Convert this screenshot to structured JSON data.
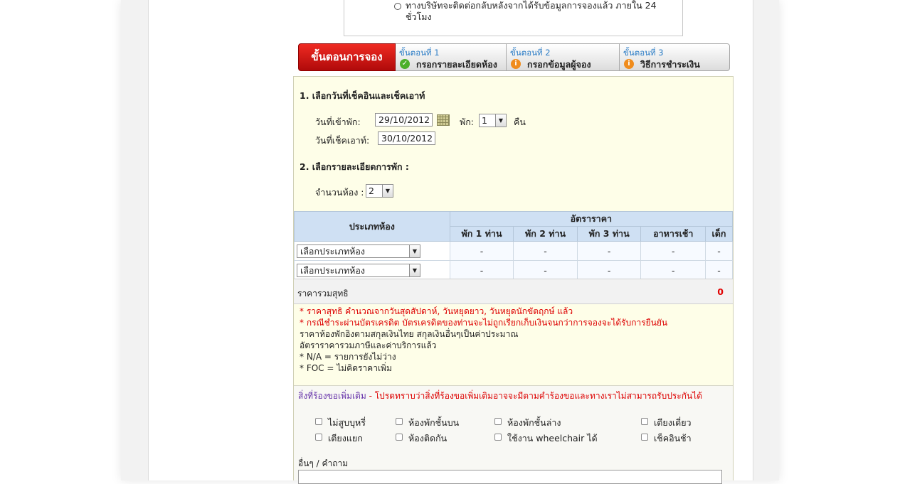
{
  "notice": {
    "text": "ทางบริษัทจะติดต่อกลับหลังจากได้รับข้อมูลการจองแล้ว ภายใน 24 ชั่วโมง"
  },
  "steps": {
    "main_label": "ขั้นตอนการจอง",
    "items": [
      {
        "num": "ขั้นตอนที่ 1",
        "label": "กรอกรายละเอียดห้อง",
        "icon": "check-icon"
      },
      {
        "num": "ขั้นตอนที่ 2",
        "label": "กรอกข้อมูลผู้จอง",
        "icon": "info-icon"
      },
      {
        "num": "ขั้นตอนที่ 3",
        "label": "วิธีการชำระเงิน",
        "icon": "info-icon"
      }
    ]
  },
  "dates": {
    "title": "1. เลือกวันที่เช็คอินและเช็คเอาท์",
    "checkin_label": "วันที่เข้าพัก:",
    "checkin_value": "29/10/2012",
    "nights_label": "พัก:",
    "nights_value": "1",
    "nights_unit": "คืน",
    "checkout_label": "วันที่เช็คเอาท์:",
    "checkout_value": "30/10/2012"
  },
  "details": {
    "title": "2. เลือกรายละเอียดการพัก :",
    "rooms_label": "จำนวนห้อง :",
    "rooms_value": "2"
  },
  "rate_table": {
    "room_type_header": "ประเภทห้อง",
    "rate_header": "อัตราราคา",
    "columns": [
      "พัก 1 ท่าน",
      "พัก 2 ท่าน",
      "พัก 3 ท่าน",
      "อาหารเช้า",
      "เด็ก"
    ],
    "rows": [
      {
        "select": "เลือกประเภทห้อง",
        "cells": [
          "-",
          "-",
          "-",
          "-",
          "-"
        ]
      },
      {
        "select": "เลือกประเภทห้อง",
        "cells": [
          "-",
          "-",
          "-",
          "-",
          "-"
        ]
      }
    ]
  },
  "total": {
    "label": "ราคารวมสุทธิ",
    "value": "0"
  },
  "notes": {
    "red_1": "* ราคาสุทธิ คำนวณจากวันสุดสัปดาห์, วันหยุดยาว, วันหยุดนักขัตฤกษ์ แล้ว",
    "red_2": "* กรณีชำระผ่านบัตรเครดิต บัตรเครดิตของท่านจะไม่ถูกเรียกเก็บเงินจนกว่าการจองจะได้รับการยืนยัน",
    "line_3": "ราคาห้องพักอิงตามสกุลเงินไทย สกุลเงินอื่นๆเป็นค่าประมาณ",
    "line_4": "อัตราราคารวมภาษีและค่าบริการแล้ว",
    "line_5": "* N/A = รายการยังไม่ว่าง",
    "line_6": "* FOC = ไม่คิดราคาเพิ่ม"
  },
  "extra": {
    "title_purple": "สิ่งที่ร้องขอเพิ่มเติม",
    "title_red": " - โปรดทราบว่าสิ่งที่ร้องขอเพิ่มเติมอาจจะมีตามคำร้องขอและทางเราไม่สามารถรับประกันได้",
    "options": [
      "ไม่สูบบุหรี่",
      "ห้องพักชั้นบน",
      "ห้องพักชั้นล่าง",
      "เตียงเดี่ยว",
      "เตียงแยก",
      "ห้องติดกัน",
      "ใช้งาน wheelchair ได้",
      "เช็คอินช้า"
    ],
    "other_label": "อื่นๆ / คำถาม"
  },
  "colors": {
    "step_main_red": "#d01717",
    "total_red": "#e00000",
    "table_header_blue": "#cfe0f3",
    "form_bg": "#fefee8"
  }
}
